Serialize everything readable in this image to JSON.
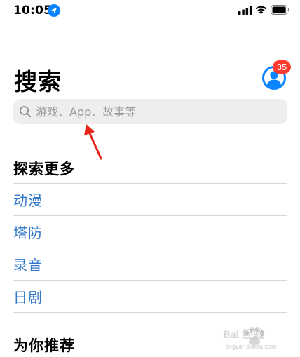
{
  "status_bar": {
    "time": "10:05",
    "icons": [
      "location-arrow-icon",
      "cellular-signal-icon",
      "wifi-icon",
      "battery-icon"
    ]
  },
  "header": {
    "title": "搜索",
    "avatar_icon": "person-circle-icon",
    "badge_count": "35"
  },
  "search": {
    "placeholder": "游戏、App、故事等",
    "value": ""
  },
  "explore": {
    "heading": "探索更多",
    "items": [
      {
        "label": "动漫"
      },
      {
        "label": "塔防"
      },
      {
        "label": "录音"
      },
      {
        "label": "日剧"
      }
    ]
  },
  "recommend": {
    "heading": "为你推荐"
  },
  "watermark": {
    "brand": "Bai 经验",
    "url": "jingyan.baidu.com"
  },
  "colors": {
    "accent": "#3478c9",
    "system_blue": "#0a84ff",
    "badge": "#ff3b30",
    "annotation": "#e8261c",
    "search_bg": "#eeeeef",
    "divider": "#d8d8dc"
  }
}
